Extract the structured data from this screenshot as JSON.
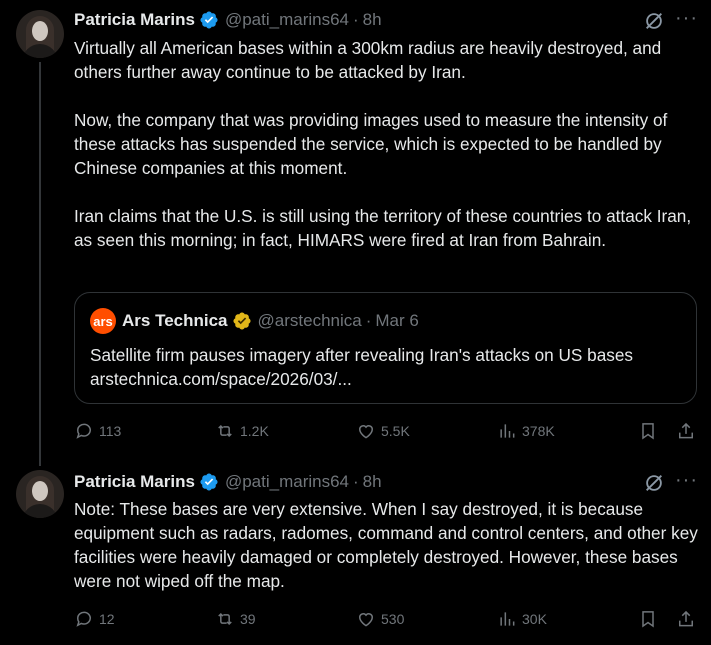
{
  "tweets": [
    {
      "author": {
        "name": "Patricia Marins",
        "handle": "@pati_marins64",
        "verified": true
      },
      "time": "8h",
      "paragraphs": [
        "Virtually all American bases within a 300km radius are heavily destroyed, and others further away continue to be attacked by Iran.",
        "Now, the company that was providing images used to measure the intensity of these attacks has suspended the service, which is expected to be handled by Chinese companies at this moment.",
        "Iran claims that the U.S. is still using the territory of these countries to attack Iran, as seen this morning; in fact, HIMARS were fired at Iran from Bahrain."
      ],
      "quote": {
        "logo_text": "ars",
        "name": "Ars Technica",
        "handle": "@arstechnica",
        "date": "Mar 6",
        "text": "Satellite firm pauses imagery after revealing Iran's attacks on US bases",
        "link": "arstechnica.com/space/2026/03/..."
      },
      "stats": {
        "replies": "113",
        "reposts": "1.2K",
        "likes": "5.5K",
        "views": "378K"
      }
    },
    {
      "author": {
        "name": "Patricia Marins",
        "handle": "@pati_marins64",
        "verified": true
      },
      "time": "8h",
      "paragraphs": [
        "Note: These bases are very extensive. When I say destroyed, it is because equipment such as radars, radomes, command and control centers, and other key facilities were heavily damaged or completely destroyed. However, these bases were not wiped off the map."
      ],
      "stats": {
        "replies": "12",
        "reposts": "39",
        "likes": "530",
        "views": "30K"
      }
    }
  ],
  "ui": {
    "dot": "·",
    "more": "···"
  },
  "colors": {
    "background": "#000000",
    "text": "#e7e9ea",
    "muted": "#71767b",
    "verified_blue": "#1d9bf0",
    "gold": "#e2b719",
    "ars_orange": "#ff4e00"
  }
}
